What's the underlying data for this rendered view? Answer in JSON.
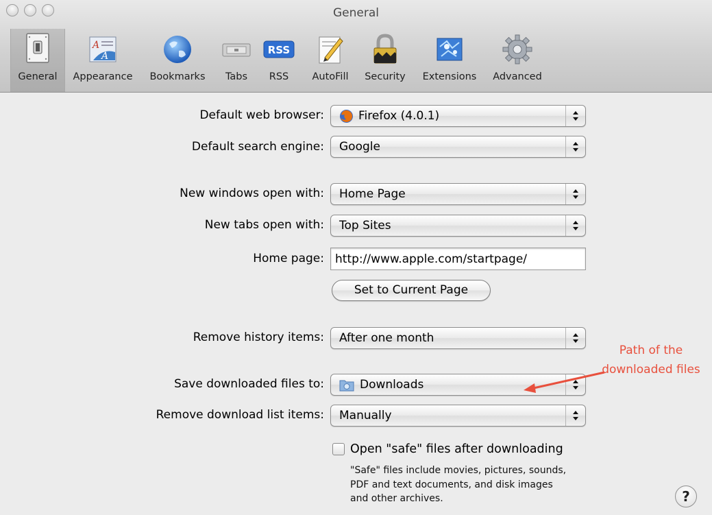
{
  "window": {
    "title": "General"
  },
  "toolbar": {
    "items": [
      {
        "label": "General",
        "icon": "switch-icon",
        "active": true
      },
      {
        "label": "Appearance",
        "icon": "appearance-icon"
      },
      {
        "label": "Bookmarks",
        "icon": "globe-icon"
      },
      {
        "label": "Tabs",
        "icon": "tabs-icon"
      },
      {
        "label": "RSS",
        "icon": "rss-icon",
        "badge": "RSS"
      },
      {
        "label": "AutoFill",
        "icon": "pencil-icon"
      },
      {
        "label": "Security",
        "icon": "lock-icon"
      },
      {
        "label": "Extensions",
        "icon": "puzzle-icon"
      },
      {
        "label": "Advanced",
        "icon": "gear-icon"
      }
    ]
  },
  "form": {
    "default_browser": {
      "label": "Default web browser:",
      "value": "Firefox (4.0.1)",
      "icon": "firefox-icon"
    },
    "search_engine": {
      "label": "Default search engine:",
      "value": "Google"
    },
    "new_windows": {
      "label": "New windows open with:",
      "value": "Home Page"
    },
    "new_tabs": {
      "label": "New tabs open with:",
      "value": "Top Sites"
    },
    "home_page": {
      "label": "Home page:",
      "value": "http://www.apple.com/startpage/"
    },
    "set_current": {
      "label": "Set to Current Page"
    },
    "remove_history": {
      "label": "Remove history items:",
      "value": "After one month"
    },
    "save_downloads": {
      "label": "Save downloaded files to:",
      "value": "Downloads",
      "icon": "folder-icon"
    },
    "remove_downloads": {
      "label": "Remove download list items:",
      "value": "Manually"
    },
    "open_safe": {
      "label": "Open \"safe\" files after downloading",
      "checked": false,
      "note_lines": [
        "\"Safe\" files include movies, pictures, sounds,",
        "PDF and text documents, and disk images",
        "and other archives."
      ]
    },
    "help": {
      "label": "?"
    }
  },
  "annotation": {
    "lines": [
      "Path of the",
      "downloaded files"
    ],
    "color": "#e8503d"
  }
}
